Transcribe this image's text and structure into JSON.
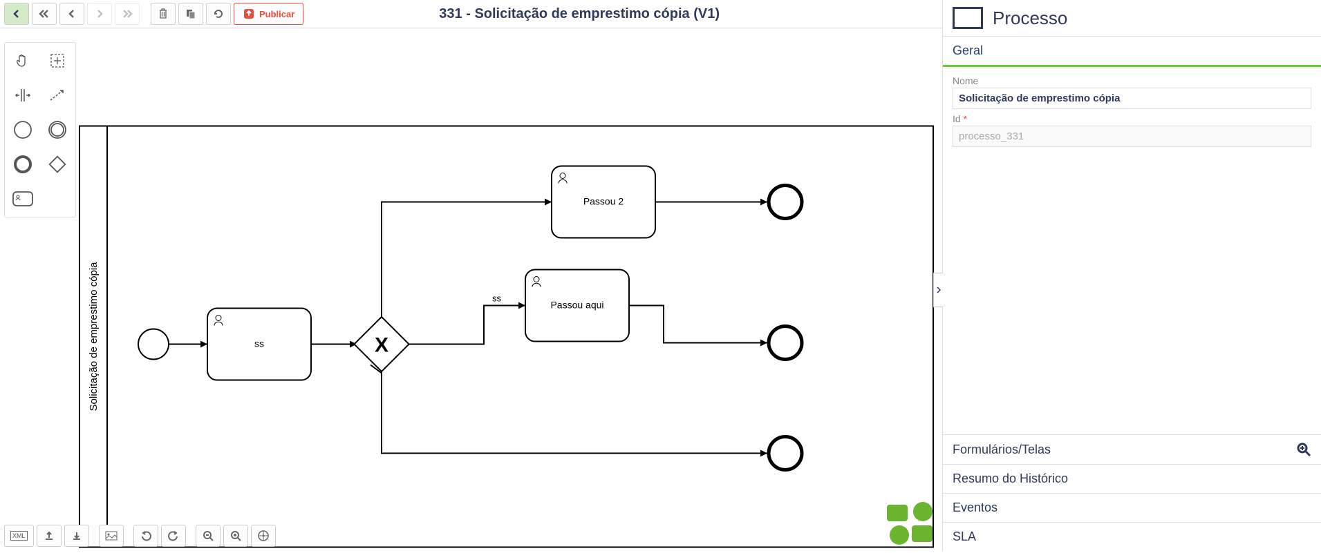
{
  "header": {
    "title": "331 - Solicitação de emprestimo cópia (V1)",
    "publish_label": "Publicar"
  },
  "diagram": {
    "pool_label": "Solicitação de emprestimo cópia",
    "tasks": {
      "t1": "ss",
      "t2": "Passou 2",
      "t3": "Passou aqui"
    },
    "flow_labels": {
      "f_ss": "ss"
    }
  },
  "side": {
    "title": "Processo",
    "sections": {
      "geral": "Geral",
      "formularios": "Formulários/Telas",
      "resumo": "Resumo do Histórico",
      "eventos": "Eventos",
      "sla": "SLA"
    },
    "fields": {
      "nome_label": "Nome",
      "nome_value": "Solicitação de emprestimo cópia",
      "id_label": "Id",
      "id_value": "processo_331"
    }
  }
}
